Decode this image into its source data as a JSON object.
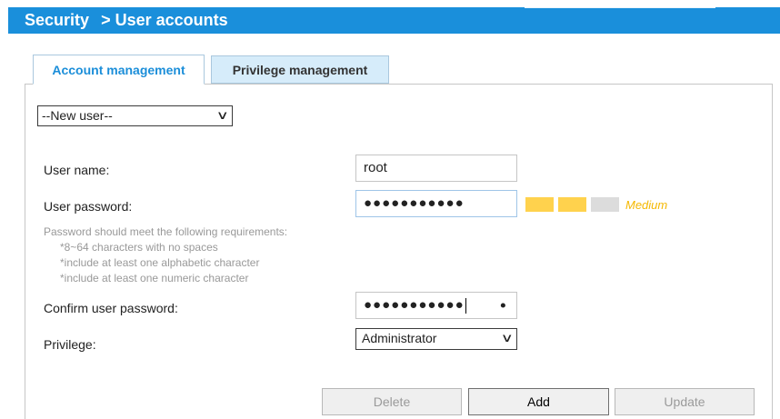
{
  "header": {
    "section": "Security",
    "separator": ">",
    "page": "User accounts"
  },
  "tabs": [
    {
      "label": "Account management",
      "active": true
    },
    {
      "label": "Privilege management",
      "active": false
    }
  ],
  "user_select": {
    "value": "--New user--"
  },
  "form": {
    "username_label": "User name:",
    "username_value": "root",
    "password_label": "User password:",
    "password_value": "●●●●●●●●●●●",
    "strength": {
      "level": 2,
      "max": 3,
      "label": "Medium"
    },
    "requirements": {
      "intro": "Password should meet the following requirements:",
      "items": [
        "*8~64 characters with no spaces",
        "*include at least one alphabetic character",
        "*include at least one numeric character"
      ]
    },
    "confirm_label": "Confirm user password:",
    "confirm_value": "●●●●●●●●●●●",
    "privilege_label": "Privilege:",
    "privilege_value": "Administrator"
  },
  "buttons": {
    "delete": "Delete",
    "add": "Add",
    "update": "Update"
  },
  "colors": {
    "header_bg": "#1a8fdb",
    "active_tab_text": "#1b8ed9",
    "inactive_tab_bg": "#d6ecfa",
    "strength_filled": "#ffd24d",
    "strength_empty": "#dcdcdc",
    "strength_text": "#f5b800"
  }
}
